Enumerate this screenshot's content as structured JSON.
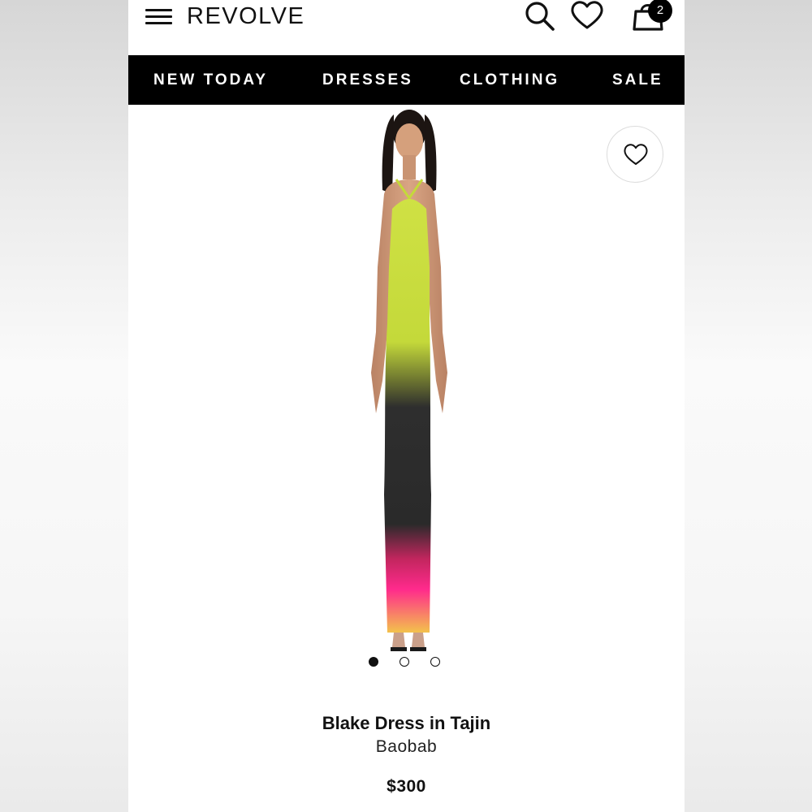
{
  "header": {
    "logo": "REVOLVE",
    "menu_icon": "hamburger-menu-icon",
    "search_icon": "search-icon",
    "wishlist_icon": "heart-icon",
    "bag_icon": "shopping-bag-icon",
    "bag_count": "2"
  },
  "nav": {
    "items": [
      {
        "label": "NEW TODAY"
      },
      {
        "label": "DRESSES"
      },
      {
        "label": "CLOTHING"
      },
      {
        "label": "SALE"
      }
    ]
  },
  "product": {
    "favorite_icon": "heart-outline-icon",
    "image_count": 3,
    "active_image": 1,
    "name": "Blake Dress in Tajin",
    "brand": "Baobab",
    "price": "$300"
  },
  "colors": {
    "nav_background": "#000000",
    "dress_lime": "#c8dc3c",
    "dress_black": "#2b2b2b",
    "dress_pink": "#ff2f8e",
    "dress_yellow": "#f2c14a"
  }
}
